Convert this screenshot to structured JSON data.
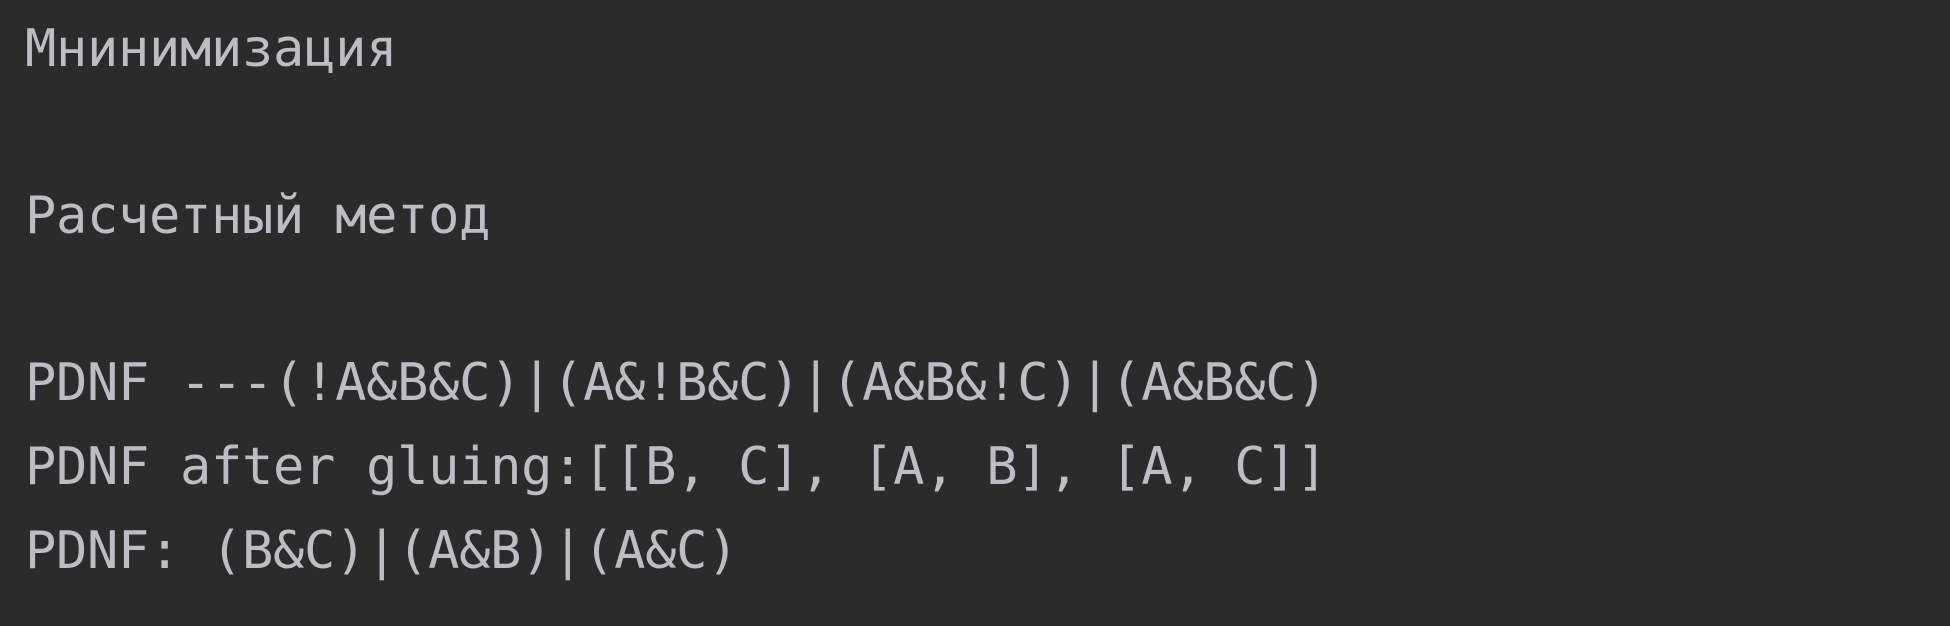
{
  "console": {
    "lines": [
      "Мнинимизация",
      "Расчетный метод",
      "PDNF ---(!A&B&C)|(A&!B&C)|(A&B&!C)|(A&B&C)",
      "PDNF after gluing:[[B, C], [A, B], [A, C]]",
      "PDNF: (B&C)|(A&B)|(A&C)"
    ]
  },
  "colors": {
    "background": "#2b2b2b",
    "text": "#bcbec4"
  }
}
